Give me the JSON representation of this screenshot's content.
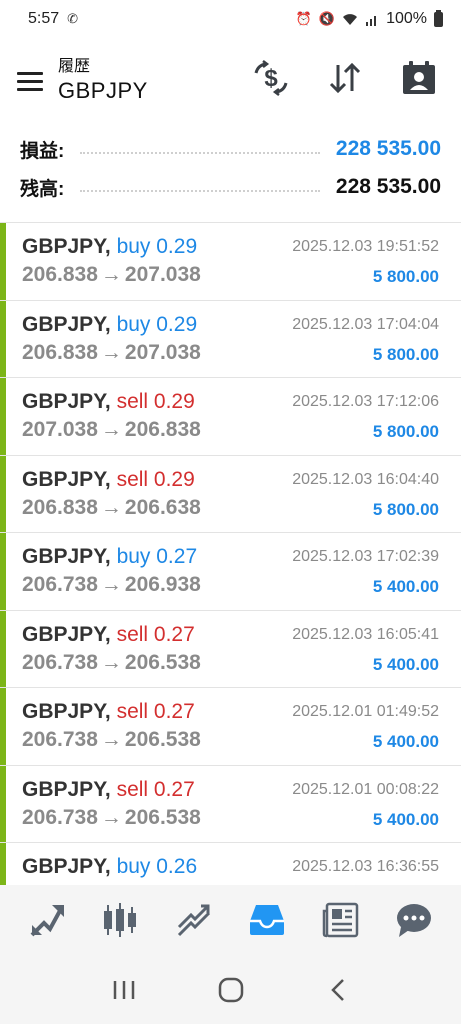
{
  "status_bar": {
    "time": "5:57",
    "battery": "100%"
  },
  "header": {
    "title": "履歴",
    "subtitle": "GBPJPY"
  },
  "summary": {
    "profit_label": "損益:",
    "profit_value": "228 535.00",
    "balance_label": "残高:",
    "balance_value": "228 535.00"
  },
  "deals": [
    {
      "symbol": "GBPJPY,",
      "side": "buy 0.29",
      "side_type": "buy",
      "time": "2025.12.03 19:51:52",
      "open": "206.838",
      "arrow": "→",
      "close": "207.038",
      "profit": "5 800.00"
    },
    {
      "symbol": "GBPJPY,",
      "side": "buy 0.29",
      "side_type": "buy",
      "time": "2025.12.03 17:04:04",
      "open": "206.838",
      "arrow": "→",
      "close": "207.038",
      "profit": "5 800.00"
    },
    {
      "symbol": "GBPJPY,",
      "side": "sell 0.29",
      "side_type": "sell",
      "time": "2025.12.03 17:12:06",
      "open": "207.038",
      "arrow": "→",
      "close": "206.838",
      "profit": "5 800.00"
    },
    {
      "symbol": "GBPJPY,",
      "side": "sell 0.29",
      "side_type": "sell",
      "time": "2025.12.03 16:04:40",
      "open": "206.838",
      "arrow": "→",
      "close": "206.638",
      "profit": "5 800.00"
    },
    {
      "symbol": "GBPJPY,",
      "side": "buy 0.27",
      "side_type": "buy",
      "time": "2025.12.03 17:02:39",
      "open": "206.738",
      "arrow": "→",
      "close": "206.938",
      "profit": "5 400.00"
    },
    {
      "symbol": "GBPJPY,",
      "side": "sell 0.27",
      "side_type": "sell",
      "time": "2025.12.03 16:05:41",
      "open": "206.738",
      "arrow": "→",
      "close": "206.538",
      "profit": "5 400.00"
    },
    {
      "symbol": "GBPJPY,",
      "side": "sell 0.27",
      "side_type": "sell",
      "time": "2025.12.01 01:49:52",
      "open": "206.738",
      "arrow": "→",
      "close": "206.538",
      "profit": "5 400.00"
    },
    {
      "symbol": "GBPJPY,",
      "side": "sell 0.27",
      "side_type": "sell",
      "time": "2025.12.01 00:08:22",
      "open": "206.738",
      "arrow": "→",
      "close": "206.538",
      "profit": "5 400.00"
    },
    {
      "symbol": "GBPJPY,",
      "side": "buy 0.26",
      "side_type": "buy",
      "time": "2025.12.03 16:36:55",
      "open": "",
      "arrow": "",
      "close": "",
      "profit": ""
    }
  ],
  "header_actions": [
    "currency-exchange-icon",
    "sort-icon",
    "calendar-user-icon"
  ],
  "bottom_nav": {
    "items": [
      "quotes-icon",
      "chart-icon",
      "trade-icon",
      "history-icon",
      "news-icon",
      "chat-icon"
    ],
    "active": "history-icon"
  },
  "system_nav": [
    "recent-apps-icon",
    "home-icon",
    "back-icon"
  ],
  "colors": {
    "accent": "#1e88e5",
    "buy": "#1e88e5",
    "sell": "#d32f2f",
    "profit": "#1e88e5",
    "deal_marker": "#7cb518",
    "active_nav": "#2196f3",
    "inactive_nav": "#5a6470"
  }
}
